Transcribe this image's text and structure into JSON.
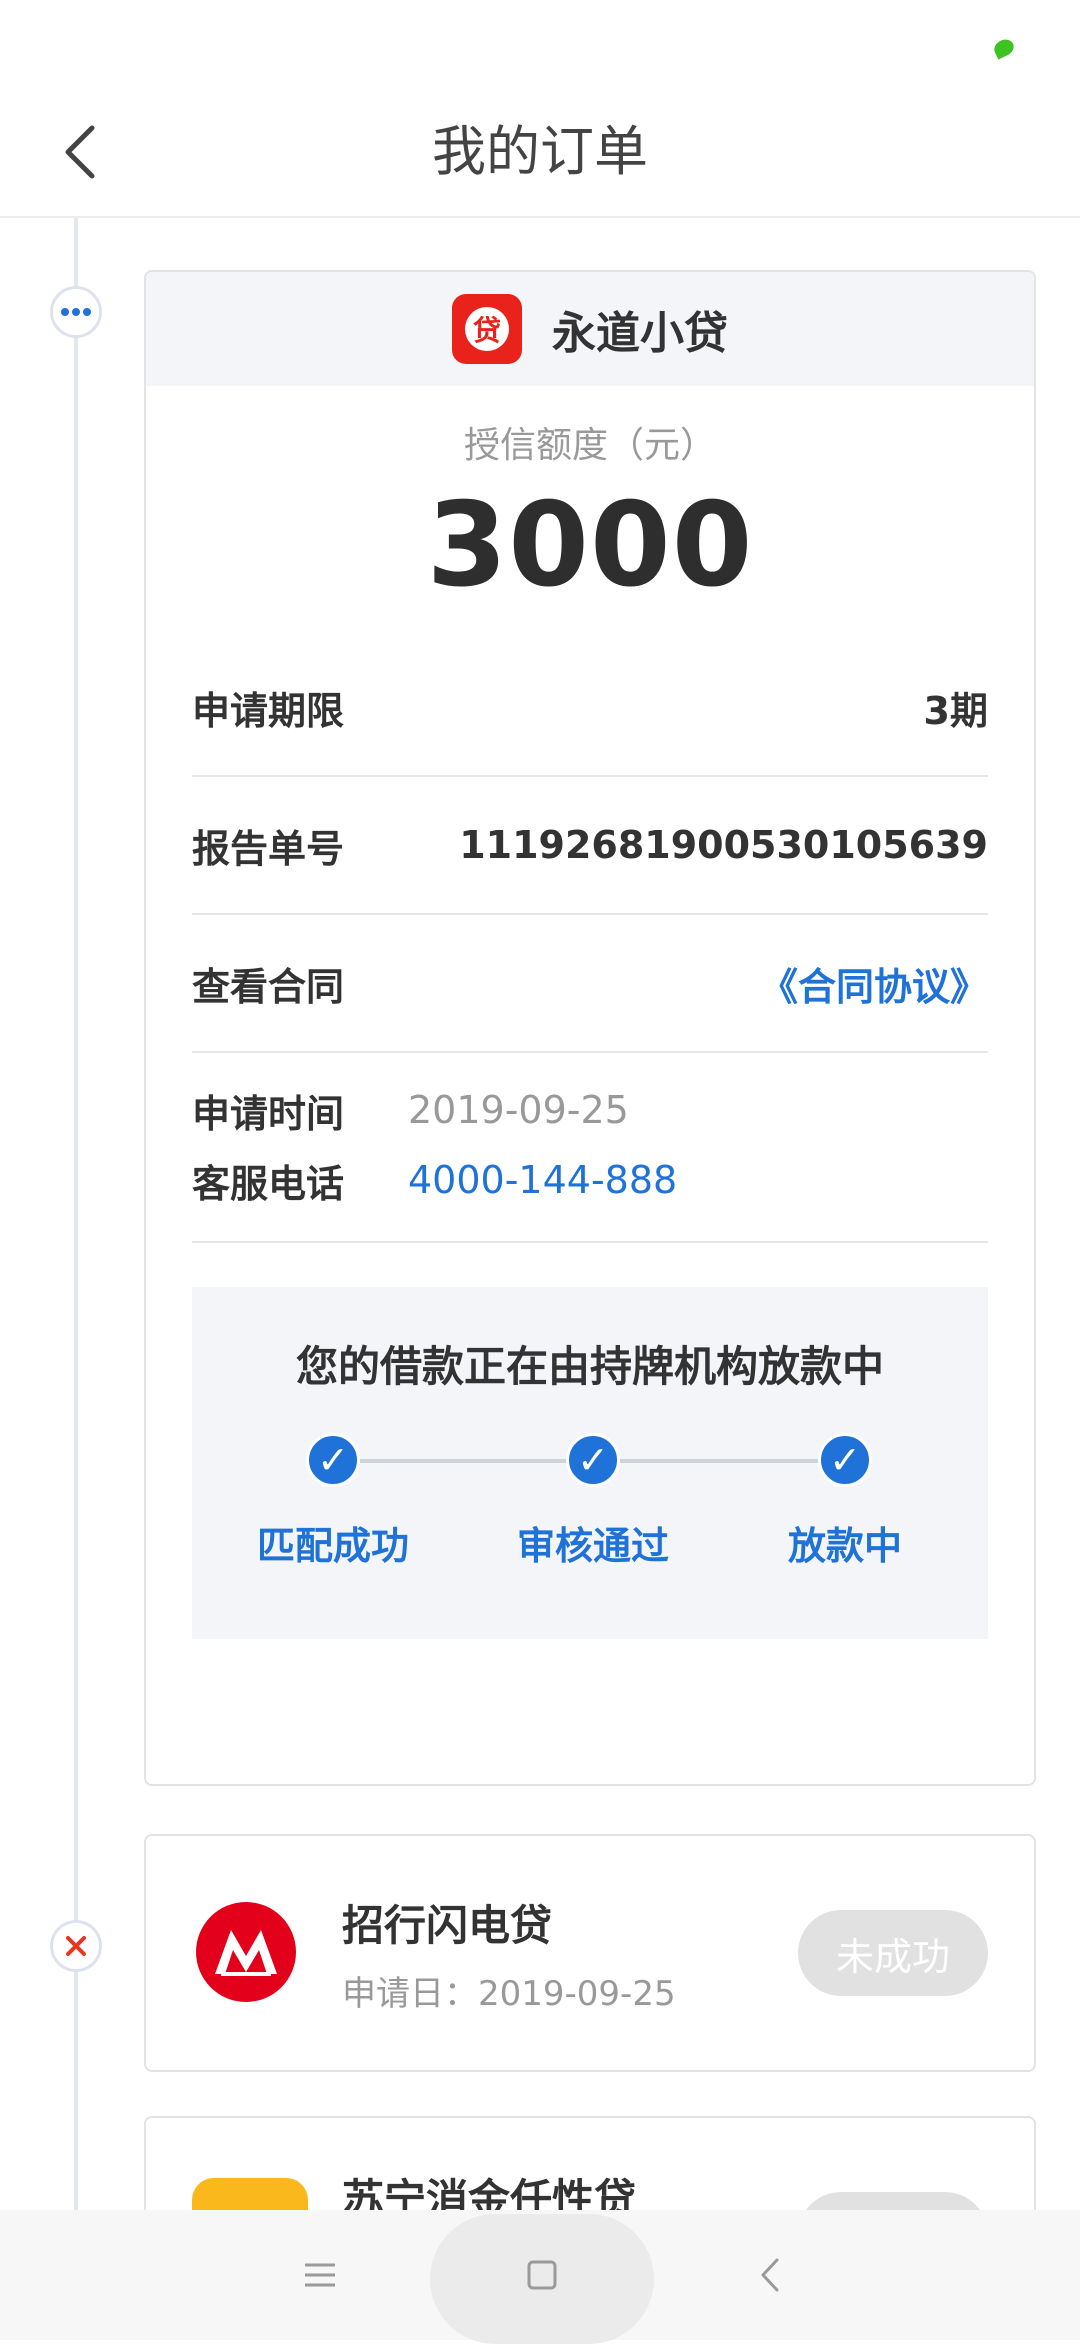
{
  "header": {
    "title": "我的订单"
  },
  "orders": [
    {
      "brand_name": "永道小贷",
      "logo_char": "贷",
      "credit_label": "授信额度（元）",
      "credit_amount": "3000",
      "rows": [
        {
          "label": "申请期限",
          "value": "3期"
        },
        {
          "label": "报告单号",
          "value": "11192681900530105639"
        },
        {
          "label": "查看合同",
          "value": "《合同协议》"
        }
      ],
      "apply_time_label": "申请时间",
      "apply_time": "2019-09-25",
      "phone_label": "客服电话",
      "phone": "4000-144-888",
      "progress": {
        "title": "您的借款正在由持牌机构放款中",
        "check_mark": "✓",
        "steps": [
          {
            "label": "匹配成功"
          },
          {
            "label": "审核通过"
          },
          {
            "label": "放款中"
          }
        ]
      }
    },
    {
      "brand_name": "招行闪电贷",
      "apply_date": "申请日：2019-09-25",
      "status": "未成功"
    },
    {
      "brand_name": "苏宁消金任性贷"
    }
  ],
  "colors": {
    "accent": "#1f72d8",
    "status_green": "#3dc421",
    "cmb_red": "#e2001a",
    "yongdao_red": "#e9231c",
    "suning_yellow": "#fbb81d"
  },
  "icons": {
    "back": "back-icon",
    "pending": "more-dots-icon",
    "failed": "close-icon",
    "nav_menu": "menu-icon",
    "nav_home": "home-square-icon",
    "nav_back": "chevron-left-icon"
  }
}
